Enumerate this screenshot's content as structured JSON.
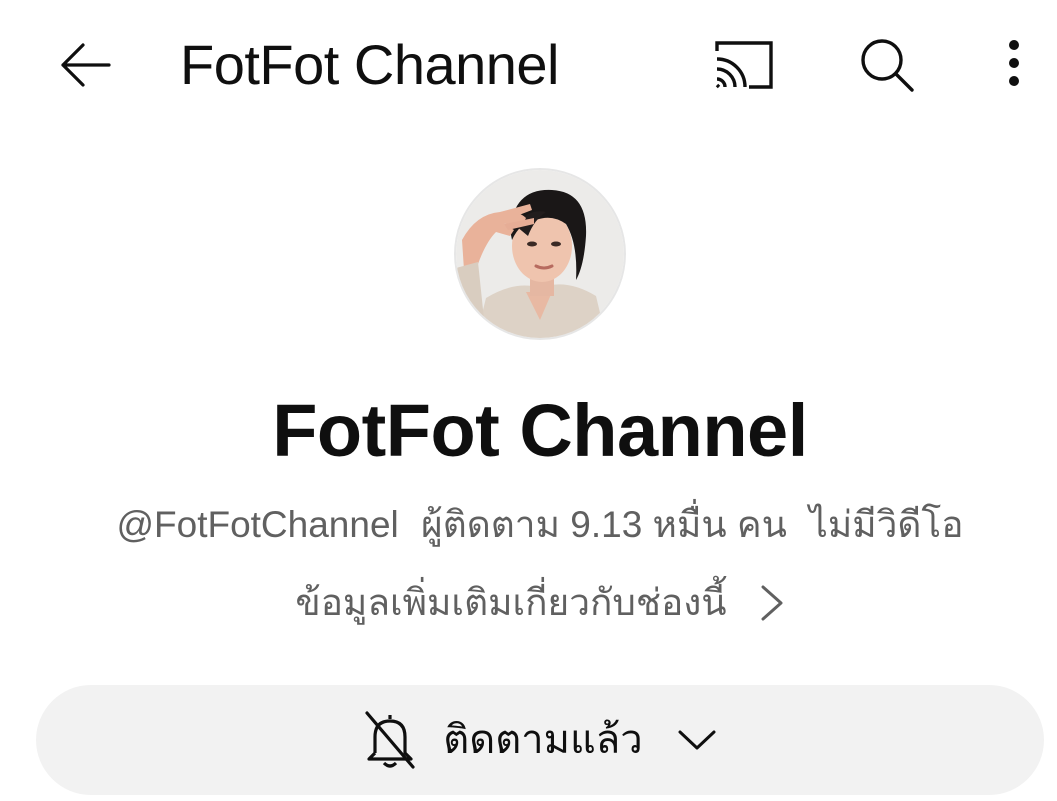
{
  "appbar": {
    "title": "FotFot Channel",
    "icons": {
      "back": "arrow-left-icon",
      "cast": "cast-icon",
      "search": "search-icon",
      "more": "more-vertical-icon"
    }
  },
  "channel": {
    "name": "FotFot Channel",
    "handle": "@FotFotChannel",
    "subscribers": "ผู้ติดตาม 9.13 หมื่น คน",
    "videos": "ไม่มีวิดีโอ",
    "more_info": "ข้อมูลเพิ่มเติมเกี่ยวกับช่องนี้"
  },
  "subscribe": {
    "label": "ติดตามแล้ว",
    "bell_icon": "bell-off-icon",
    "dropdown_icon": "chevron-down-icon"
  },
  "colors": {
    "text": "#0f0f0f",
    "secondary_text": "#606060",
    "button_bg": "#f2f2f2"
  }
}
